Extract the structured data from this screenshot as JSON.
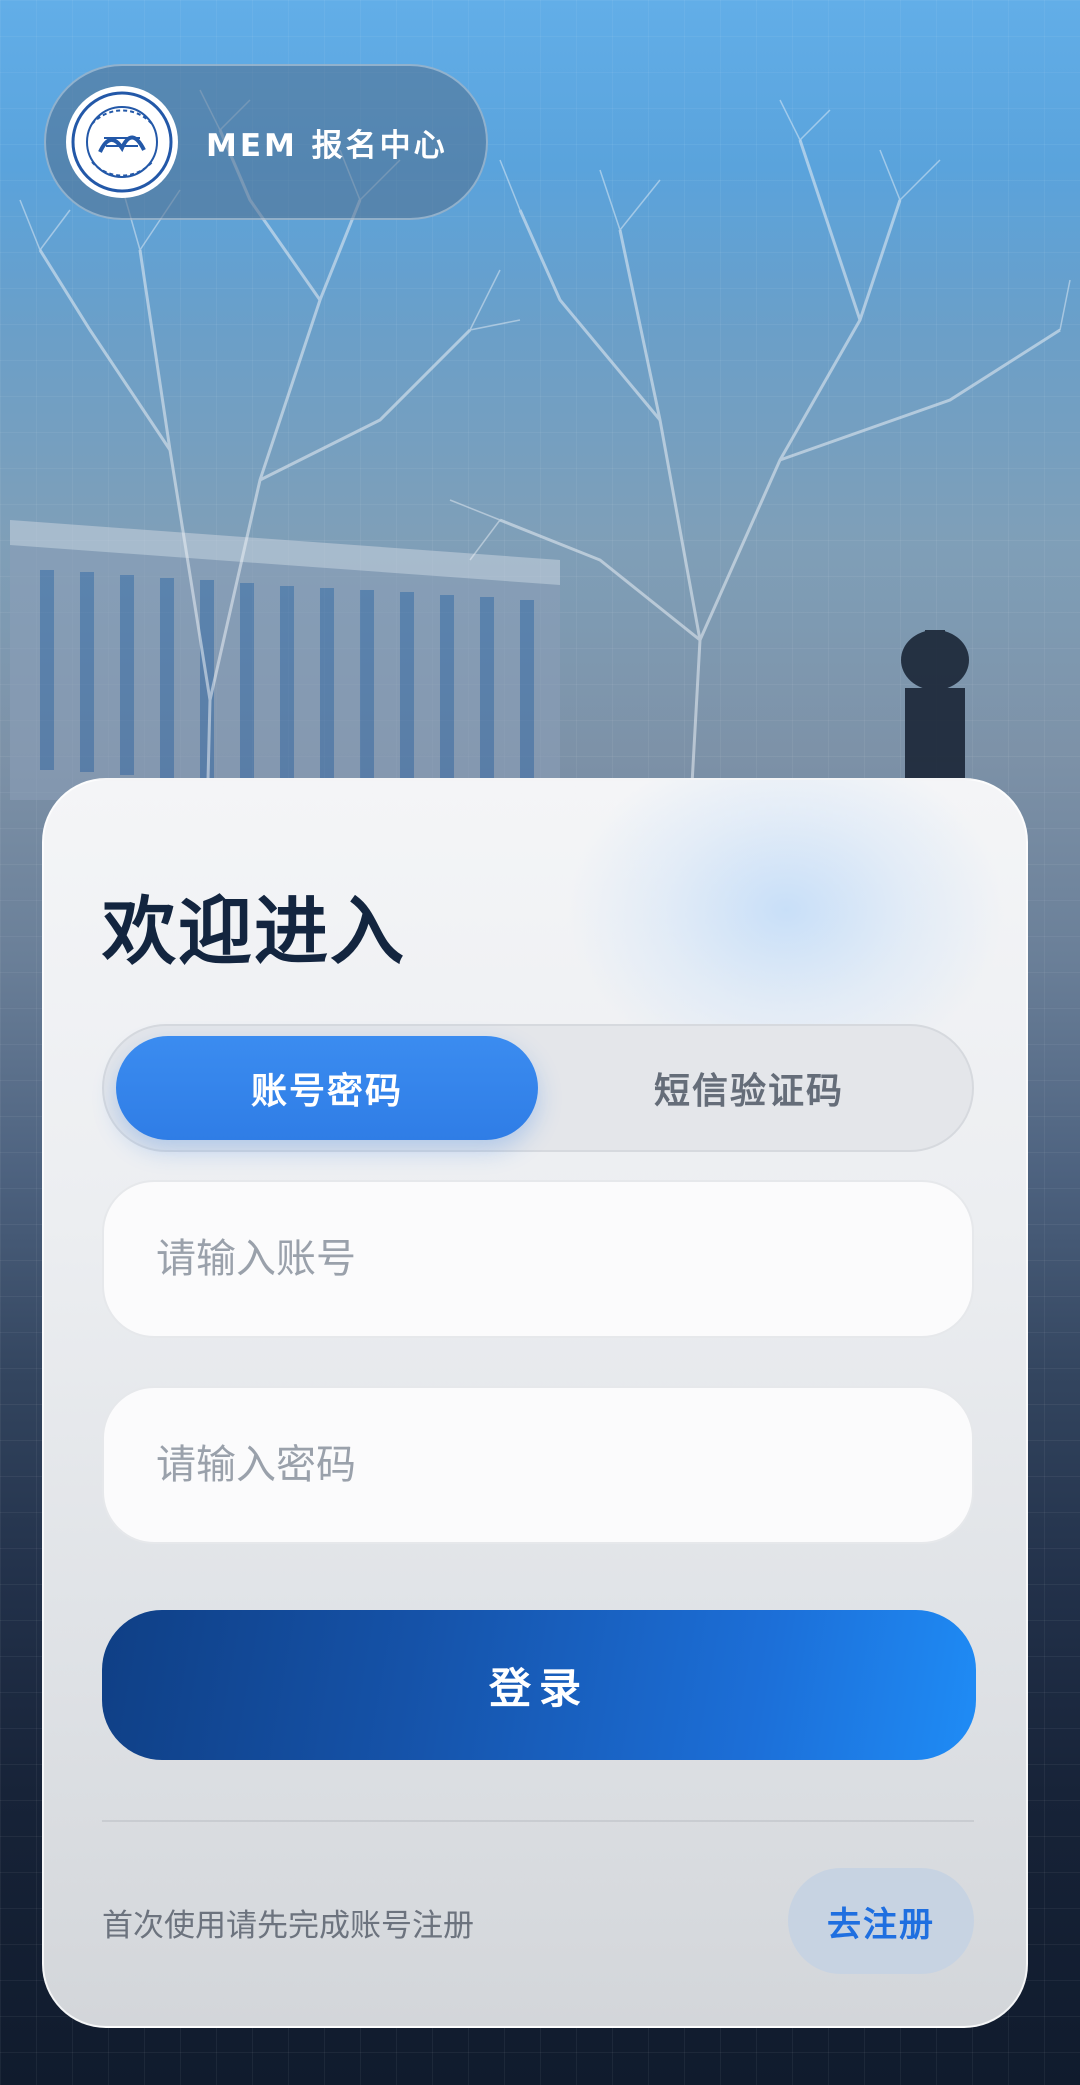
{
  "header": {
    "brand_name": "MEM 报名中心",
    "logo_icon": "tongji-university-seal-icon",
    "logo_text_top": "同济大学",
    "logo_year": "1907",
    "logo_text_bottom": "TONGJI UNIVERSITY"
  },
  "login": {
    "welcome_title": "欢迎进入",
    "tabs": [
      {
        "label": "账号密码",
        "active": true
      },
      {
        "label": "短信验证码",
        "active": false
      }
    ],
    "account_placeholder": "请输入账号",
    "password_placeholder": "请输入密码",
    "submit_label": "登录"
  },
  "footer": {
    "hint": "首次使用请先完成账号注册",
    "register_label": "去注册"
  },
  "colors": {
    "accent": "#2f7de6",
    "title": "#13253f",
    "register_text": "#1f6fe0"
  }
}
